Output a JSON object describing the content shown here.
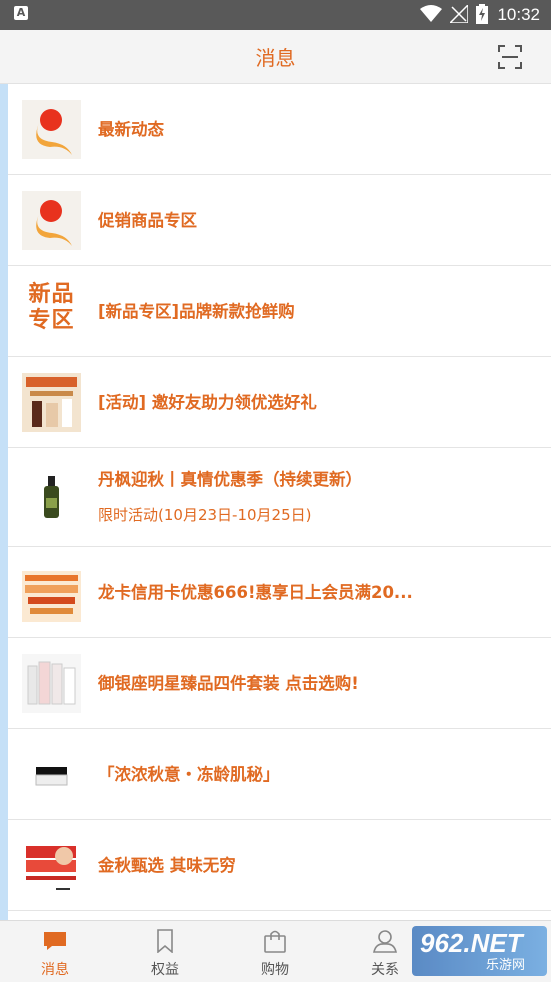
{
  "status_bar": {
    "time": "10:32",
    "notification_icon": "A"
  },
  "header": {
    "title": "消息",
    "scan_icon": "scan-icon"
  },
  "messages": [
    {
      "title": "最新动态",
      "thumb": "brand-logo"
    },
    {
      "title": "促销商品专区",
      "thumb": "brand-logo"
    },
    {
      "title": "[新品专区]品牌新款抢鲜购",
      "thumb": "new-product-text",
      "thumb_text": "新品专区"
    },
    {
      "title": "[活动] 邀好友助力领优选好礼",
      "thumb": "promo-image"
    },
    {
      "title": "丹枫迎秋丨真情优惠季（持续更新）",
      "subtitle": "限时活动(10月23日-10月25日)",
      "thumb": "serum-bottle"
    },
    {
      "title": "龙卡信用卡优惠666!惠享日上会员满20...",
      "thumb": "credit-card-promo"
    },
    {
      "title": "御银座明星臻品四件套装 点击选购!",
      "thumb": "cosmetics-set"
    },
    {
      "title": "「浓浓秋意・冻龄肌秘」",
      "thumb": "cream-jar"
    },
    {
      "title": "金秋甄选 其味无穷",
      "thumb": "snack-pack"
    }
  ],
  "nav": [
    {
      "label": "消息",
      "icon": "message-icon",
      "active": true
    },
    {
      "label": "权益",
      "icon": "bookmark-icon",
      "active": false
    },
    {
      "label": "购物",
      "icon": "shopping-bag-icon",
      "active": false
    },
    {
      "label": "关系",
      "icon": "person-icon",
      "active": false
    }
  ],
  "watermark": {
    "line1": "962.NET",
    "line2": "乐游网"
  },
  "colors": {
    "accent": "#e06a22",
    "side_bar": "#c5e0f7",
    "status_bar": "#595959"
  }
}
